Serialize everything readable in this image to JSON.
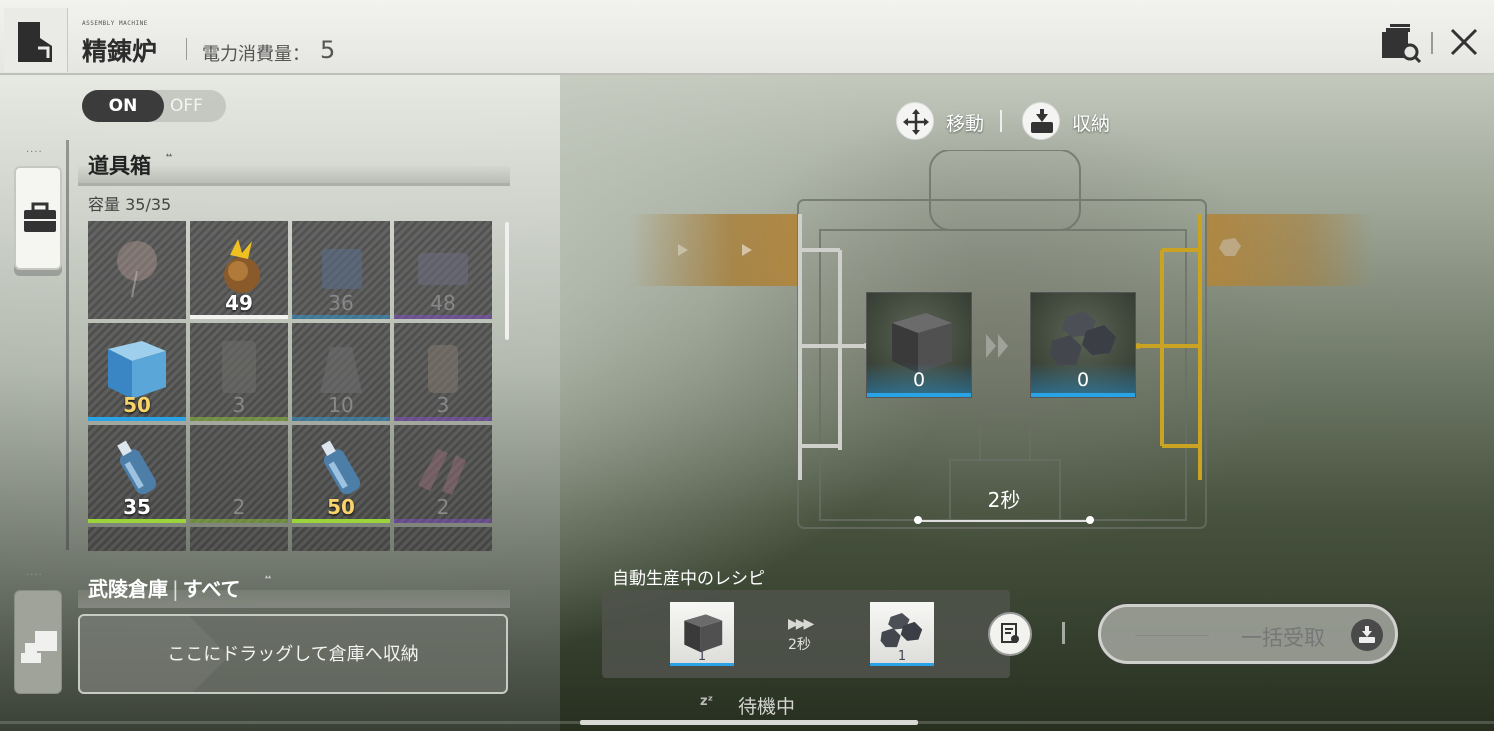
{
  "header": {
    "module_tag": "ASSEMBLY MACHINE",
    "title": "精錬炉",
    "power_label": "電力消費量：",
    "power_value": "5"
  },
  "toggle": {
    "on_label": "ON",
    "off_label": "OFF",
    "state": "on"
  },
  "inventory": {
    "title": "道具箱",
    "capacity": "容量 35/35",
    "items": [
      {
        "icon": "dried-flower-icon",
        "count": "",
        "rarity": "none",
        "dim": true
      },
      {
        "icon": "golden-bulb-icon",
        "count": "49",
        "rarity": "#f2f2f0",
        "dim": false
      },
      {
        "icon": "blue-device-icon",
        "count": "36",
        "rarity": "#2aa3e6",
        "dim": true
      },
      {
        "icon": "purple-device-icon",
        "count": "48",
        "rarity": "#8a4fd8",
        "dim": true
      },
      {
        "icon": "blue-ore-cube-icon",
        "count": "50",
        "rarity": "#2aa3e6",
        "dim": false,
        "gold": true
      },
      {
        "icon": "green-machine-icon",
        "count": "3",
        "rarity": "#9bd43a",
        "dim": true
      },
      {
        "icon": "blue-machine-icon",
        "count": "10",
        "rarity": "#2aa3e6",
        "dim": true
      },
      {
        "icon": "purple-machine-icon",
        "count": "3",
        "rarity": "#8a4fd8",
        "dim": true
      },
      {
        "icon": "water-bottle-icon",
        "count": "35",
        "rarity": "#9bd43a",
        "dim": false
      },
      {
        "icon": "empty-slot-icon",
        "count": "2",
        "rarity": "#9bd43a",
        "dim": true
      },
      {
        "icon": "water-bottle-icon",
        "count": "50",
        "rarity": "#9bd43a",
        "dim": false,
        "gold": true
      },
      {
        "icon": "purple-parts-icon",
        "count": "2",
        "rarity": "#8a4fd8",
        "dim": true
      }
    ]
  },
  "warehouse": {
    "title": "武陵倉庫",
    "filter": "すべて",
    "drop_text": "ここにドラッグして倉庫へ収納"
  },
  "actions": {
    "move": "移動",
    "store": "収納"
  },
  "machine": {
    "input_count": "0",
    "output_count": "0",
    "time": "2秒"
  },
  "recipe": {
    "title": "自動生産中のレシピ",
    "input_count": "1",
    "output_count": "1",
    "time": "2秒"
  },
  "collect_label": "一括受取",
  "status": "待機中",
  "colors": {
    "accent_blue": "#2aa3e6",
    "belt": "#b0863e",
    "rare_purple": "#8a4fd8",
    "uncommon_green": "#9bd43a"
  }
}
